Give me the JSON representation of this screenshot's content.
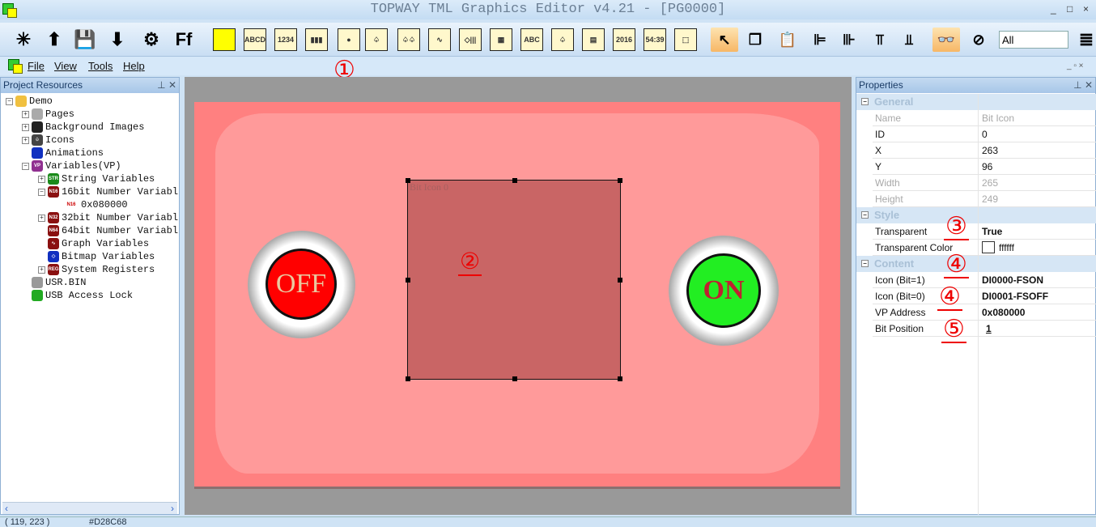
{
  "window": {
    "title": "TOPWAY TML Graphics Editor v4.21 - [PG0000]",
    "min": "_",
    "max": "□",
    "close": "×"
  },
  "toolbar": {
    "items": [
      {
        "name": "new-project-icon",
        "glyph": "✳"
      },
      {
        "name": "open-project-icon",
        "glyph": "⬆"
      },
      {
        "name": "save-icon",
        "glyph": "💾"
      },
      {
        "name": "import-icon",
        "glyph": "⬇"
      },
      {
        "name": "settings-tools-icon",
        "glyph": "⚙"
      },
      {
        "name": "font-icon",
        "glyph": "Ff"
      },
      {
        "name": "rectangle-icon",
        "glyph": ""
      },
      {
        "name": "text-string-icon",
        "glyph": "ABCD"
      },
      {
        "name": "number-icon",
        "glyph": "1234"
      },
      {
        "name": "bargraph-icon",
        "glyph": "▮▮▮"
      },
      {
        "name": "bit-icon-tool",
        "glyph": "●"
      },
      {
        "name": "icon-tool",
        "glyph": "♤"
      },
      {
        "name": "animation-icon",
        "glyph": "♤♤"
      },
      {
        "name": "graph-icon",
        "glyph": "∿"
      },
      {
        "name": "bitmap-icon",
        "glyph": "◇|||"
      },
      {
        "name": "qr-code-icon",
        "glyph": "▦"
      },
      {
        "name": "text-box-icon",
        "glyph": "ABC"
      },
      {
        "name": "touch-icon",
        "glyph": "♤"
      },
      {
        "name": "video-icon",
        "glyph": "▤"
      },
      {
        "name": "date-time-icon",
        "glyph": "2016"
      },
      {
        "name": "timer-icon",
        "glyph": "54:39"
      },
      {
        "name": "touch-area-icon",
        "glyph": "⬚"
      },
      {
        "name": "pointer-icon",
        "glyph": "↖"
      },
      {
        "name": "copy-icon",
        "glyph": "❐"
      },
      {
        "name": "paste-icon",
        "glyph": "📋"
      },
      {
        "name": "align-left-icon",
        "glyph": "⊫"
      },
      {
        "name": "align-right-icon",
        "glyph": "⊪"
      },
      {
        "name": "align-top-icon",
        "glyph": "⫪"
      },
      {
        "name": "align-bottom-icon",
        "glyph": "⫫"
      },
      {
        "name": "show-icon",
        "glyph": "👓"
      },
      {
        "name": "hide-icon",
        "glyph": "⊘"
      }
    ],
    "filter_value": "All",
    "list_icon": "≣"
  },
  "menu": {
    "items": [
      "File",
      "View",
      "Tools",
      "Help"
    ]
  },
  "annotations": {
    "a1": "①",
    "a2": "②",
    "a3": "③",
    "a4a": "④",
    "a4b": "④",
    "a5": "⑤"
  },
  "project": {
    "title": "Project Resources",
    "tree": [
      {
        "label": "Demo",
        "level": 0,
        "icon": "folder-icon",
        "badge": "",
        "color": "#f0c040",
        "exp": "−"
      },
      {
        "label": "Pages",
        "level": 1,
        "icon": "pages-icon",
        "badge": "",
        "color": "#aaa",
        "exp": "+"
      },
      {
        "label": "Background Images",
        "level": 1,
        "icon": "background-images-icon",
        "badge": "",
        "color": "#222",
        "exp": "+"
      },
      {
        "label": "Icons",
        "level": 1,
        "icon": "icons-icon",
        "badge": "♤",
        "color": "#444",
        "exp": "+"
      },
      {
        "label": "Animations",
        "level": 1,
        "icon": "animations-icon",
        "badge": "",
        "color": "#1030c0",
        "exp": ""
      },
      {
        "label": "Variables(VP)",
        "level": 1,
        "icon": "variables-icon",
        "badge": "VP",
        "color": "#903090",
        "exp": "−"
      },
      {
        "label": "String Variables",
        "level": 2,
        "icon": "string-variables-icon",
        "badge": "STR",
        "color": "#1a8a1a",
        "exp": "+"
      },
      {
        "label": "16bit Number Variabl",
        "level": 2,
        "icon": "n16-icon",
        "badge": "N16",
        "color": "#8a1010",
        "exp": "−"
      },
      {
        "label": "0x080000",
        "level": 3,
        "icon": "n16-item-icon",
        "badge": "N16",
        "color": "",
        "exp": ""
      },
      {
        "label": "32bit Number Variabl",
        "level": 2,
        "icon": "n32-icon",
        "badge": "N32",
        "color": "#8a1010",
        "exp": "+"
      },
      {
        "label": "64bit Number Variabl",
        "level": 2,
        "icon": "n64-icon",
        "badge": "N64",
        "color": "#8a1010",
        "exp": ""
      },
      {
        "label": "Graph Variables",
        "level": 2,
        "icon": "graph-variables-icon",
        "badge": "∿",
        "color": "#8a1010",
        "exp": ""
      },
      {
        "label": "Bitmap Variables",
        "level": 2,
        "icon": "bitmap-variables-icon",
        "badge": "◇",
        "color": "#1030c0",
        "exp": ""
      },
      {
        "label": "System Registers",
        "level": 2,
        "icon": "system-registers-icon",
        "badge": "REG",
        "color": "#8a1010",
        "exp": "+"
      },
      {
        "label": "USR.BIN",
        "level": 1,
        "icon": "file-icon",
        "badge": "",
        "color": "#999",
        "exp": ""
      },
      {
        "label": "USB Access Lock",
        "level": 1,
        "icon": "usb-lock-icon",
        "badge": "",
        "color": "#2a2",
        "exp": ""
      }
    ]
  },
  "canvas": {
    "selection_label": "Bit Icon 0",
    "off_label": "OFF",
    "on_label": "ON",
    "page_color": "#ff8080",
    "selection_color": "#c96565"
  },
  "properties": {
    "title": "Properties",
    "categories": [
      {
        "name": "General",
        "rows": [
          {
            "k": "Name",
            "v": "Bit Icon",
            "dis": true
          },
          {
            "k": "ID",
            "v": "0"
          },
          {
            "k": "X",
            "v": "263"
          },
          {
            "k": "Y",
            "v": "96"
          },
          {
            "k": "Width",
            "v": "265",
            "dis": true
          },
          {
            "k": "Height",
            "v": "249",
            "dis": true
          }
        ]
      },
      {
        "name": "Style",
        "rows": [
          {
            "k": "Transparent",
            "v": "True",
            "bold": true
          },
          {
            "k": "Transparent Color",
            "v": "ffffff",
            "swatch": "#ffffff"
          }
        ]
      },
      {
        "name": "Content",
        "rows": [
          {
            "k": "Icon (Bit=1)",
            "v": "DI0000-FSON",
            "bold": true
          },
          {
            "k": "Icon (Bit=0)",
            "v": "DI0001-FSOFF",
            "bold": true
          },
          {
            "k": "VP Address",
            "v": "0x080000",
            "bold": true
          },
          {
            "k": "Bit Position",
            "v": "1",
            "bold": true,
            "ul": true
          }
        ]
      }
    ]
  },
  "status": {
    "coords": "( 119, 223 )",
    "color": "#D28C68"
  }
}
